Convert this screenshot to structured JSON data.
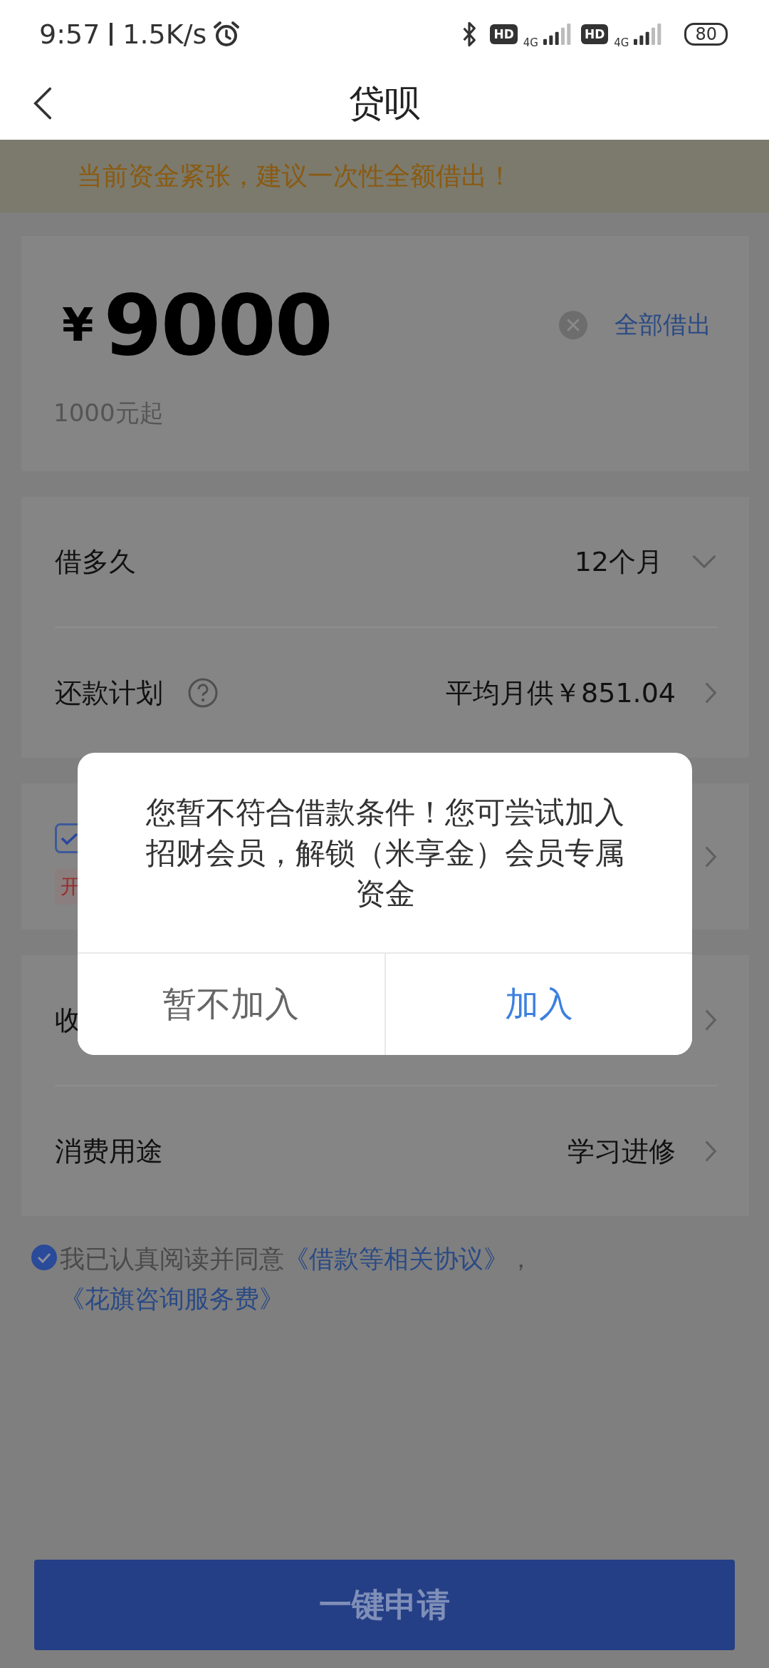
{
  "status_bar": {
    "time": "9:57",
    "speed": "1.5K/s",
    "sims": [
      {
        "badge": "HD",
        "network": "4G"
      },
      {
        "badge": "HD",
        "network": "4G"
      }
    ],
    "battery": "80"
  },
  "nav": {
    "title": "贷呗"
  },
  "notice": "当前资金紧张，建议一次性全额借出！",
  "amount": {
    "currency": "¥",
    "value": "9000",
    "hint": "1000元起",
    "action": "全部借出"
  },
  "term": {
    "label": "借多久",
    "value": "12个月"
  },
  "plan": {
    "label": "还款计划",
    "value": "平均月供￥851.04"
  },
  "option": {
    "checked": true,
    "tag": "开"
  },
  "receive": {
    "label": "收"
  },
  "purpose": {
    "label": "消费用途",
    "value": "学习进修"
  },
  "agreement": {
    "checked": true,
    "text": "我已认真阅读并同意",
    "links": [
      "《借款等相关协议》",
      "《花旗咨询服务费》"
    ],
    "separator": "，"
  },
  "submit": "一键申请",
  "dialog": {
    "message": "您暂不符合借款条件！您可尝试加入招财会员，解锁（米享金）会员专属资金",
    "buttons": [
      {
        "label": "暂不加入",
        "kind": "secondary"
      },
      {
        "label": "加入",
        "kind": "primary"
      }
    ]
  }
}
